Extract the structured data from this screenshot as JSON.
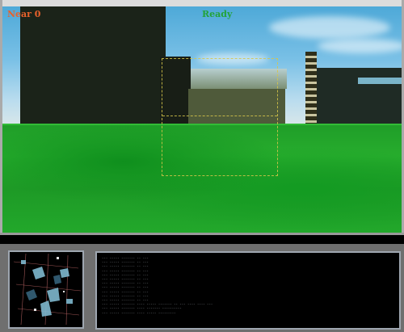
{
  "hud": {
    "top_left_label": "Near 0",
    "status_label": "Ready"
  },
  "console": {
    "lines": [
      "--- ----- ------- -- ---",
      "--- ----- ------- -- ---",
      "--- ----- ------- -- ---",
      "--- ----- ------- -- ---",
      "--- ----- ------- -- ---",
      "--- ----- ------- -- ---",
      "--- ----- ------- -- ---",
      "--- ----- ------- -- ---",
      "--- ----- ------- -- ---",
      "--- ----- ------- -- ---",
      "--- ----- ------- -- ---",
      "--- ----- ------- ---- ----- ------- -- ---     ---- ---- ---",
      "--- ----- ------- ---- ------- ----------",
      "--- ----- ------- ---- ----- ---------"
    ]
  },
  "colors": {
    "sky": "#4ea9d8",
    "ground": "#22a82b",
    "hud_left": "#e8612c",
    "hud_status": "#23a33a",
    "target_box": "#d7c64a",
    "panel_bg": "#6f6f6f"
  }
}
